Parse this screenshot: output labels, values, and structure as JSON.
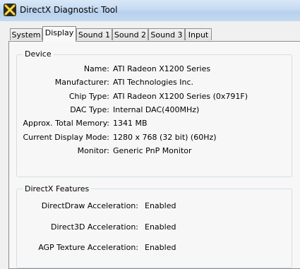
{
  "window": {
    "title": "DirectX Diagnostic Tool"
  },
  "tabs": [
    {
      "label": "System",
      "active": false
    },
    {
      "label": "Display",
      "active": true
    },
    {
      "label": "Sound 1",
      "active": false
    },
    {
      "label": "Sound 2",
      "active": false
    },
    {
      "label": "Sound 3",
      "active": false
    },
    {
      "label": "Input",
      "active": false
    }
  ],
  "device": {
    "heading": "Device",
    "rows": [
      {
        "label": "Name:",
        "value": "ATI Radeon X1200 Series"
      },
      {
        "label": "Manufacturer:",
        "value": "ATI Technologies Inc."
      },
      {
        "label": "Chip Type:",
        "value": "ATI Radeon X1200 Series (0x791F)"
      },
      {
        "label": "DAC Type:",
        "value": "Internal DAC(400MHz)"
      },
      {
        "label": "Approx. Total Memory:",
        "value": "1341 MB"
      },
      {
        "label": "Current Display Mode:",
        "value": "1280 x 768 (32 bit) (60Hz)"
      },
      {
        "label": "Monitor:",
        "value": "Generic PnP Monitor"
      }
    ]
  },
  "features": {
    "heading": "DirectX Features",
    "rows": [
      {
        "label": "DirectDraw Acceleration:",
        "value": "Enabled"
      },
      {
        "label": "Direct3D Acceleration:",
        "value": "Enabled"
      },
      {
        "label": "AGP Texture Acceleration:",
        "value": "Enabled"
      }
    ]
  }
}
